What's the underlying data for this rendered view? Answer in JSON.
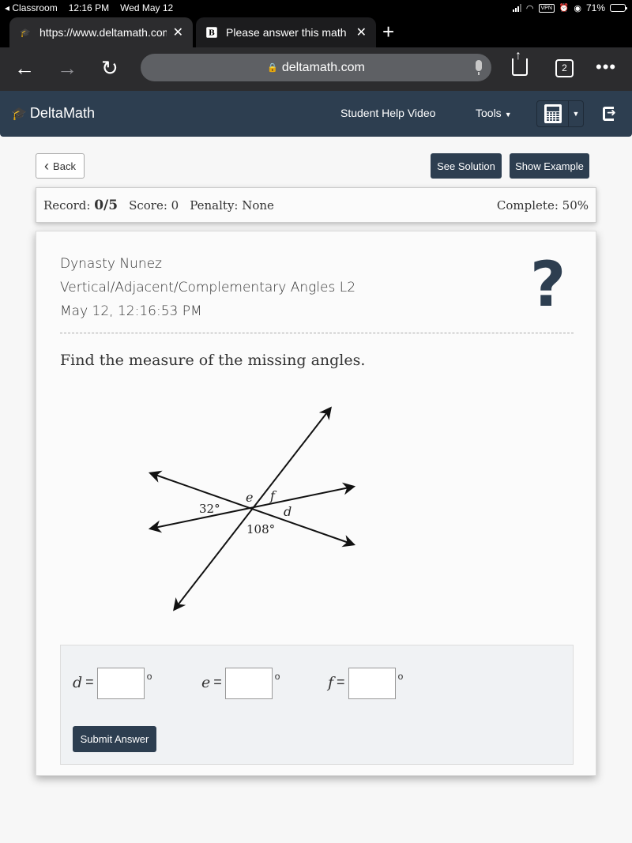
{
  "status_bar": {
    "back_app": "◂ Classroom",
    "time": "12:16 PM",
    "date": "Wed May 12",
    "vpn": "VPN",
    "battery": "71%",
    "battery_level": 0.71
  },
  "browser": {
    "tabs": [
      {
        "title": "https://www.deltamath.com",
        "favicon": "graduation-cap-icon",
        "close": "✕",
        "active": true
      },
      {
        "title": "Please answer this math question",
        "favicon": "B",
        "close": "✕",
        "active": false
      }
    ],
    "new_tab": "+",
    "url": "deltamath.com",
    "tab_count": "2",
    "back": "←",
    "forward": "→",
    "reload": "↻",
    "more": "•••"
  },
  "header": {
    "brand": "DeltaMath",
    "help_video": "Student Help Video",
    "tools": "Tools",
    "caret": "▼"
  },
  "actions": {
    "back": "Back",
    "back_chevron": "‹",
    "see_solution": "See Solution",
    "show_example": "Show Example"
  },
  "record": {
    "record_label": "Record:",
    "record_value": "0/5",
    "score": "Score: 0",
    "penalty": "Penalty: None",
    "complete": "Complete: 50%"
  },
  "problem": {
    "student": "Dynasty Nunez",
    "topic": "Vertical/Adjacent/Complementary Angles L2",
    "timestamp": "May 12, 12:16:53 PM",
    "help_symbol": "?",
    "prompt": "Find the measure of the missing angles.",
    "diagram_labels": {
      "known_1": "32°",
      "known_2": "108°",
      "e": "e",
      "f": "f",
      "d": "d"
    }
  },
  "answers": {
    "fields": [
      {
        "var": "d",
        "eq": "=",
        "value": "",
        "deg": "o"
      },
      {
        "var": "e",
        "eq": "=",
        "value": "",
        "deg": "o"
      },
      {
        "var": "f",
        "eq": "=",
        "value": "",
        "deg": "o"
      }
    ],
    "submit": "Submit Answer"
  }
}
